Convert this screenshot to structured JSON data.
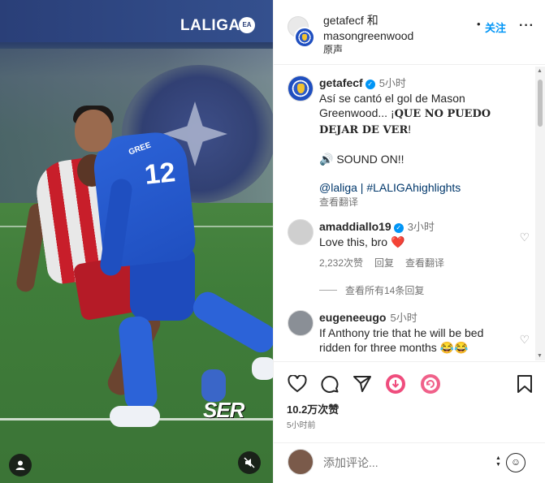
{
  "video": {
    "watermark": "LALIGA",
    "watermark_badge": "EA",
    "broadcaster": "SER",
    "jersey_number": "12",
    "jersey_name": "GREE"
  },
  "header": {
    "title_line1": "getafecf 和",
    "title_line2": "masongreenwood",
    "audio": "原声",
    "follow_dot": "•",
    "follow": "关注",
    "more": "···"
  },
  "caption": {
    "username": "getafecf",
    "time": "5小时",
    "text_line1": "Así se cantó el gol de Mason Greenwood... ¡",
    "text_bold": "QUE NO PUEDO DEJAR DE VER",
    "text_end": "!",
    "sound": "🔊 SOUND ON!!",
    "mention": "@laliga",
    "sep": " | ",
    "hashtag": "#LALIGAhighlights",
    "translate": "查看翻译"
  },
  "comments": [
    {
      "username": "amaddiallo19",
      "time": "3小时",
      "text": "Love this, bro ❤️",
      "likes": "2,232次赞",
      "reply": "回复",
      "translate": "查看翻译"
    },
    {
      "username": "eugeneeugo",
      "time": "5小时",
      "text": "If Anthony trie that he will be bed ridden for three months 😂😂"
    }
  ],
  "replies_link": "查看所有14条回复",
  "actions": {
    "likes": "10.2万次赞",
    "date": "5小时前"
  },
  "add_comment": {
    "placeholder": "添加评论..."
  }
}
